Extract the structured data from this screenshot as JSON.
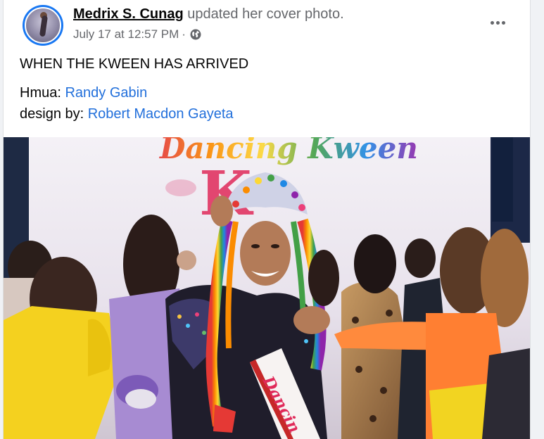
{
  "post": {
    "author": "Medrix S. Cunag",
    "action": " updated her cover photo.",
    "timestamp": "July 17 at 12:57 PM",
    "separator": "·",
    "privacy_icon": "globe-icon",
    "more_icon": "more-options-icon",
    "caption_line1": "WHEN THE KWEEN HAS ARRIVED",
    "hmua_label": "Hmua: ",
    "hmua_name": "Randy Gabin",
    "design_label": "design by: ",
    "design_name": "Robert Macdon Gayeta"
  },
  "photo": {
    "backdrop_text": "Dancing Kween",
    "sash_text": "Dancin"
  },
  "colors": {
    "link": "#216fdb",
    "muted": "#65676b",
    "text": "#050505",
    "background": "#f0f2f5",
    "avatar_ring": "#1877f2"
  }
}
